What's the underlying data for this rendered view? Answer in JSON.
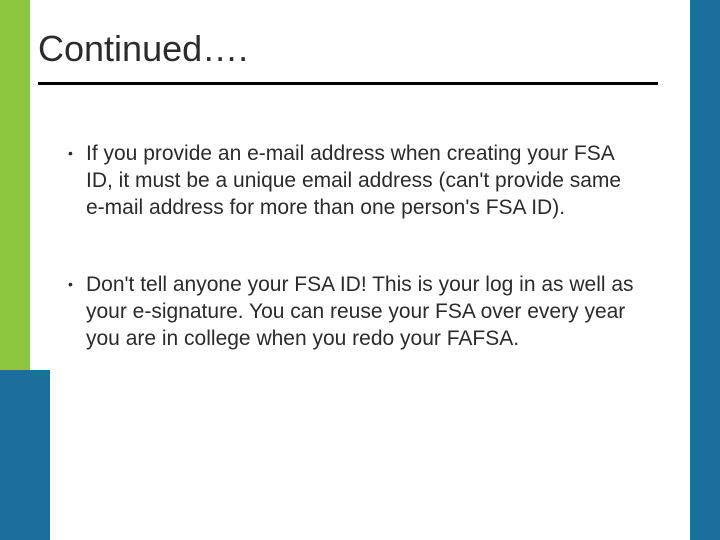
{
  "slide": {
    "title": "Continued….",
    "bullets": [
      {
        "text": "If you provide an e-mail address when creating your FSA ID, it must be a unique email address (can't provide same e-mail address for more than one person's FSA ID)."
      },
      {
        "text": "Don't tell anyone your FSA ID! This is your log in as well as your e-signature. You can reuse your FSA over every year you are in college when you redo your FAFSA."
      }
    ],
    "colors": {
      "green": "#8cc63f",
      "blue": "#1b6f9c"
    }
  }
}
